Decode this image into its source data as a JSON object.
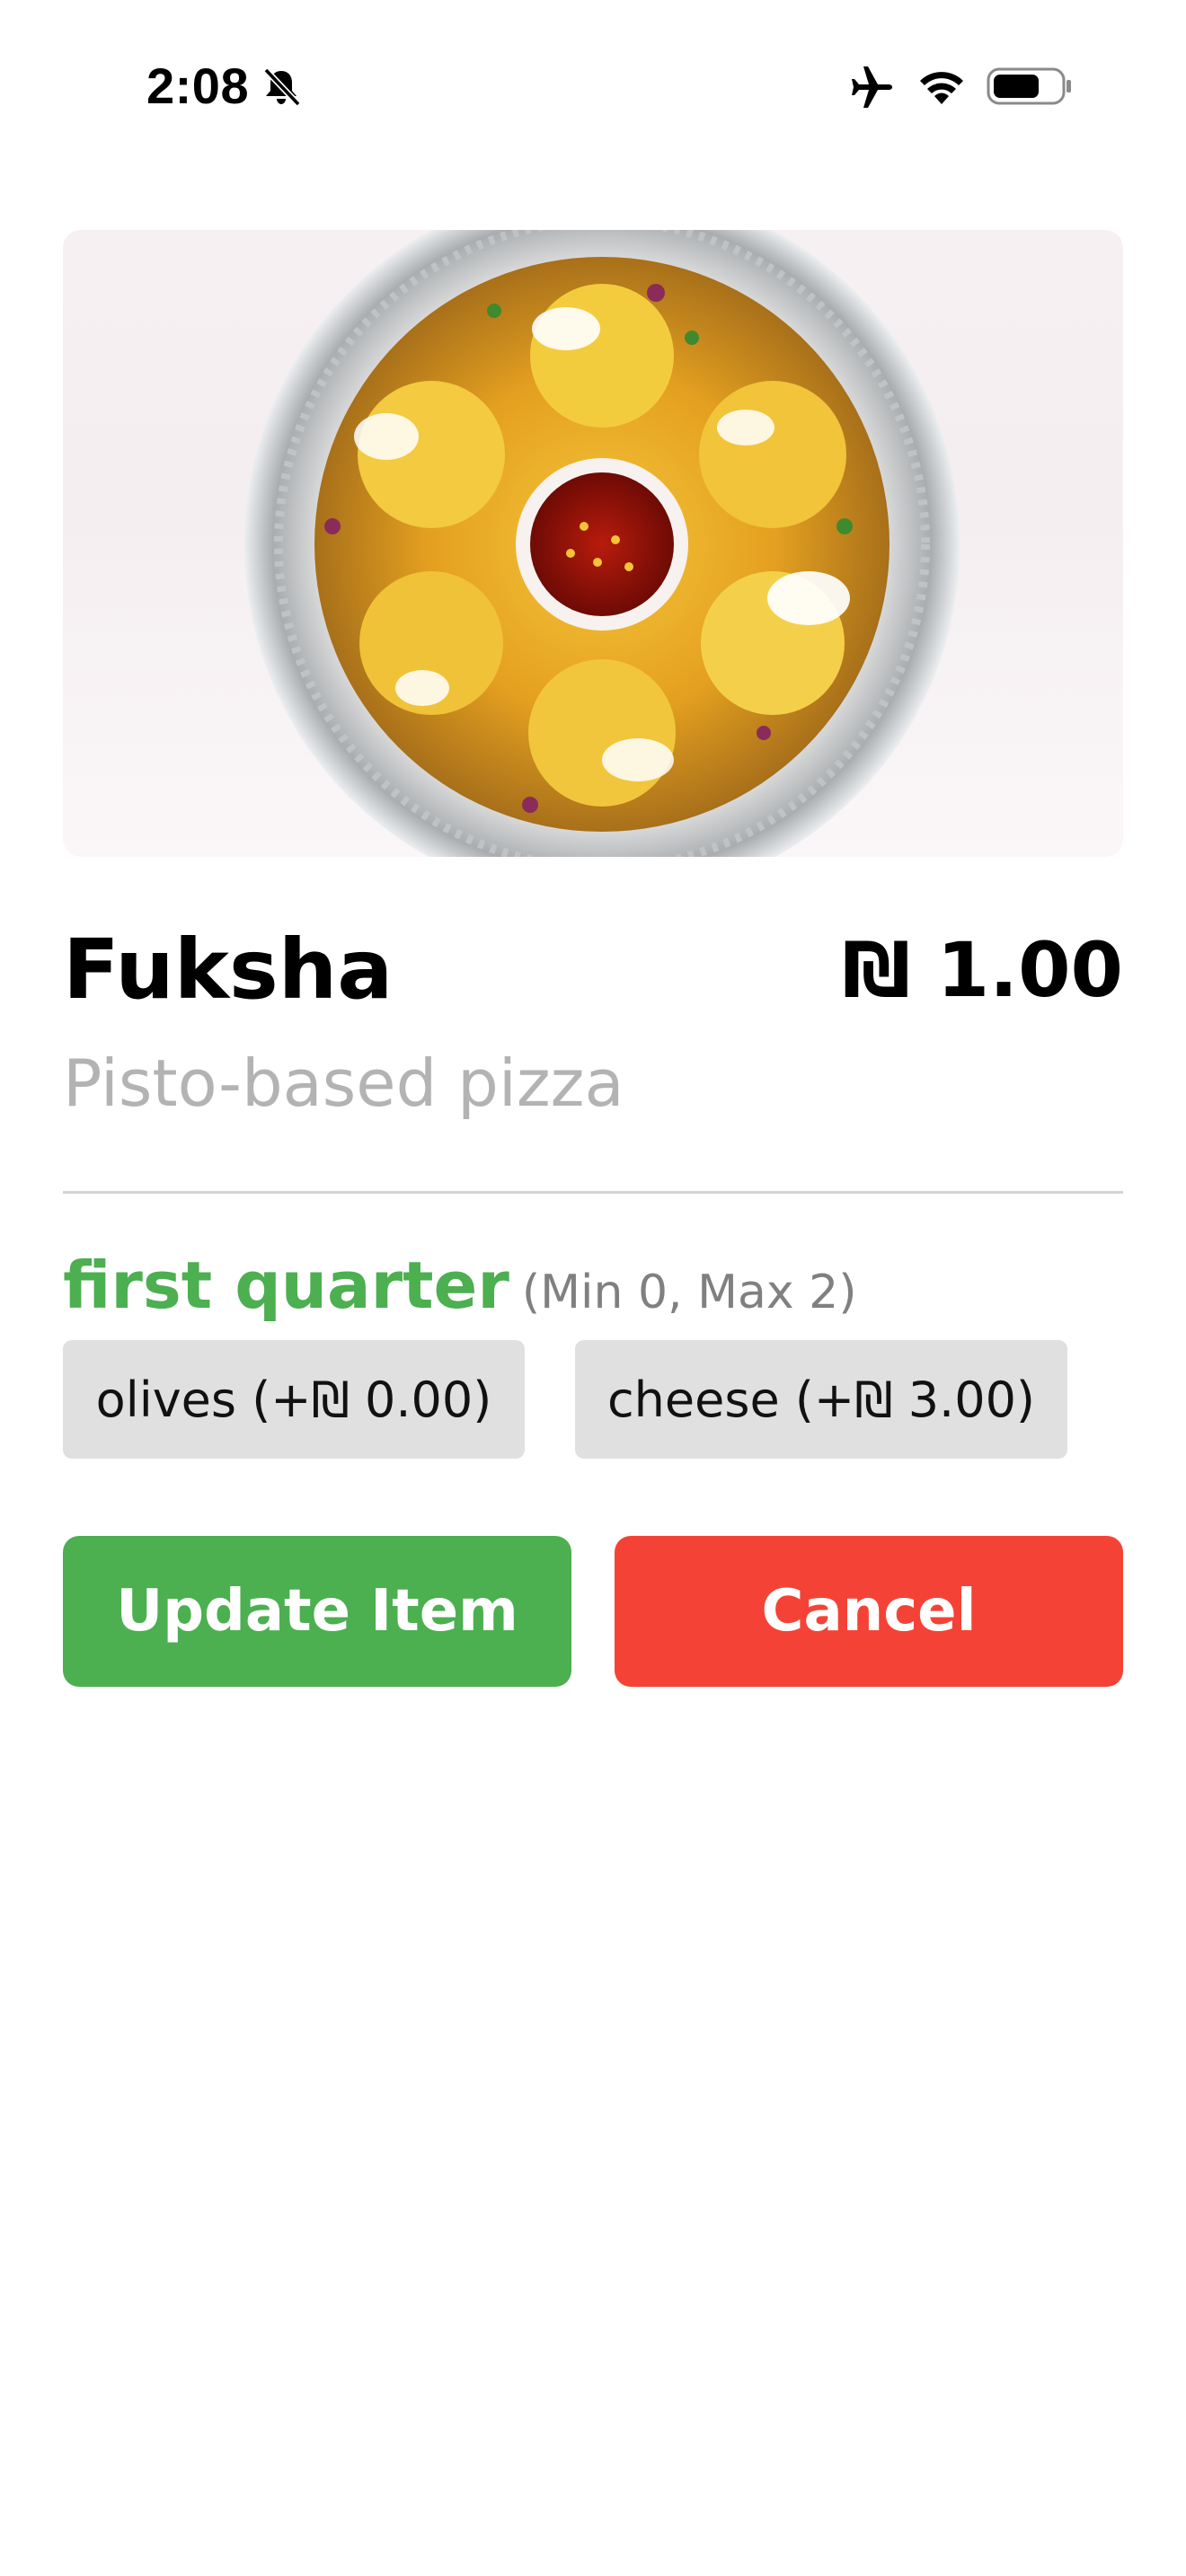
{
  "status_bar": {
    "time": "2:08",
    "icons": [
      "bell-slash-icon",
      "airplane-icon",
      "wifi-icon",
      "battery-icon"
    ]
  },
  "hero_image": {
    "subject": "bowl of fuksha topped with sev, onion and chutney cup"
  },
  "item": {
    "name": "Fuksha",
    "price": "₪ 1.00",
    "description": "Pisto-based pizza"
  },
  "modifier_group": {
    "title": "first quarter",
    "limits": "(Min 0, Max 2)",
    "options": [
      {
        "label": "olives (+₪ 0.00)"
      },
      {
        "label": "cheese (+₪ 3.00)"
      }
    ]
  },
  "actions": {
    "update_label": "Update Item",
    "cancel_label": "Cancel"
  },
  "colors": {
    "accent_green": "#4caf50",
    "cancel_red": "#f44336",
    "chip_gray": "#e0e0e0",
    "muted_text": "#b3b3b3"
  }
}
